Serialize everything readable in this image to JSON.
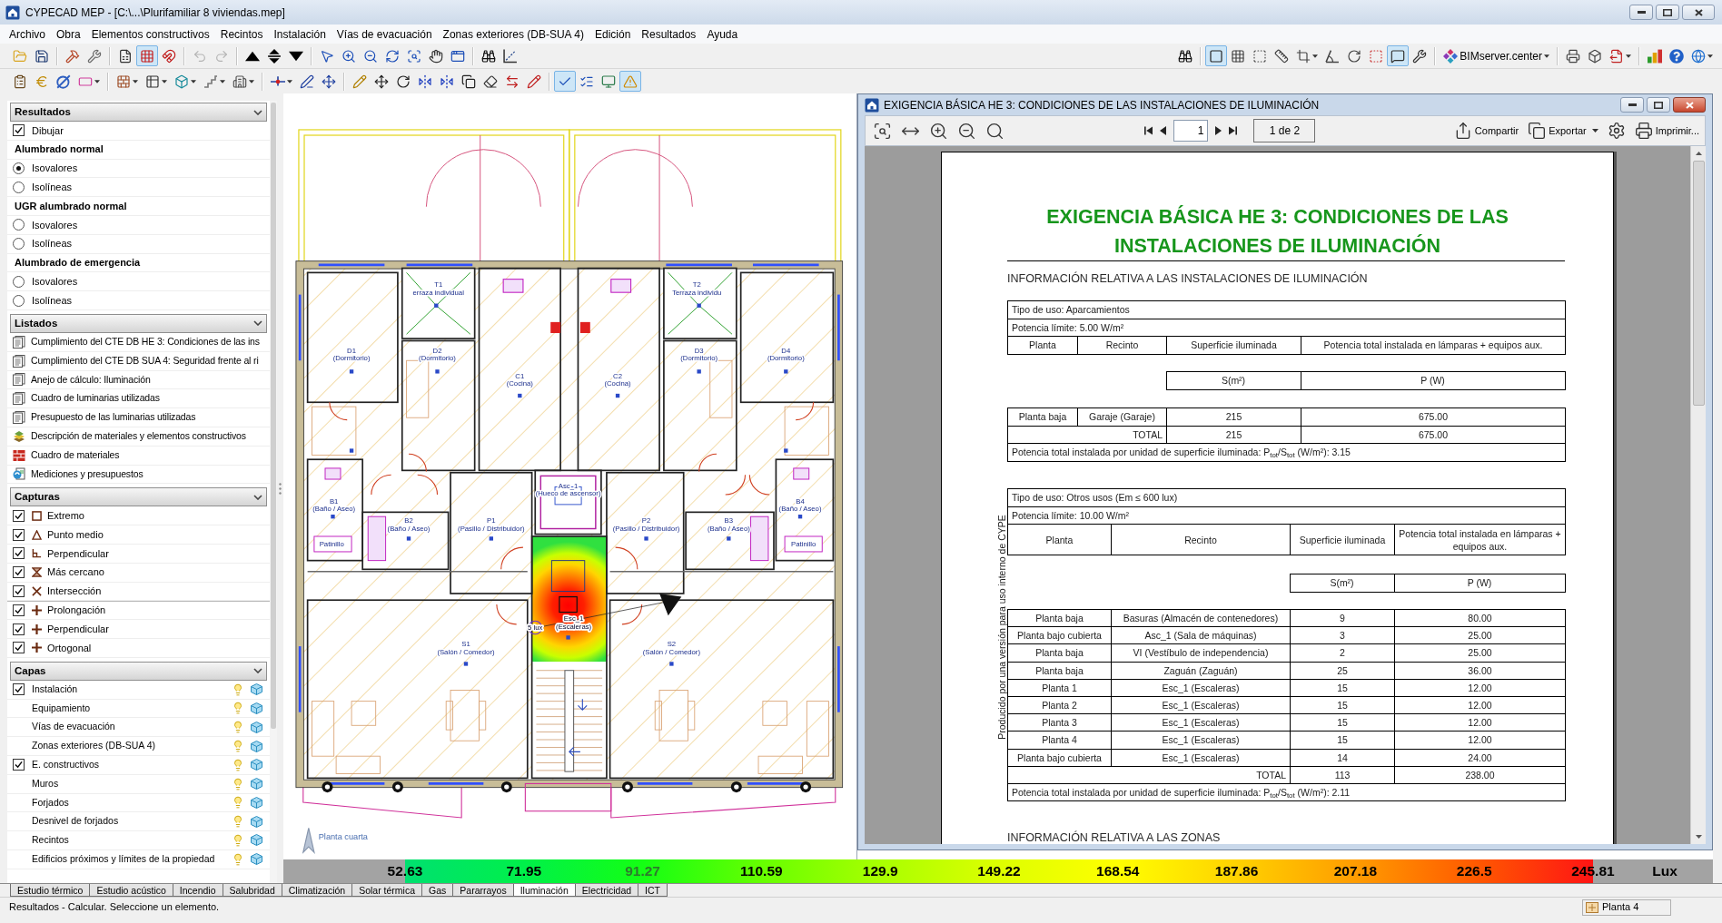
{
  "window": {
    "title": "CYPECAD MEP - [C:\\...\\Plurifamiliar 8 viviendas.mep]"
  },
  "menu": [
    "Archivo",
    "Obra",
    "Elementos constructivos",
    "Recintos",
    "Instalación",
    "Vías de evacuación",
    "Zonas exteriores (DB-SUA 4)",
    "Edición",
    "Resultados",
    "Ayuda"
  ],
  "toolbar_1": {
    "left": [
      [
        {
          "pressed": false,
          "disabled": false
        },
        {
          "pressed": false,
          "disabled": false
        }
      ],
      [
        {
          "pressed": false,
          "disabled": false
        },
        {
          "pressed": false,
          "disabled": false
        }
      ],
      [
        {
          "pressed": false,
          "disabled": false
        },
        {
          "pressed": true,
          "disabled": false
        },
        {
          "pressed": false,
          "disabled": false
        }
      ],
      [
        {
          "pressed": false,
          "disabled": true
        },
        {
          "pressed": false,
          "disabled": true
        }
      ],
      [
        {
          "pressed": false,
          "disabled": false
        },
        {
          "pressed": false,
          "disabled": false
        },
        {
          "pressed": false,
          "disabled": false
        }
      ],
      [
        {
          "pressed": false,
          "disabled": false
        },
        {
          "pressed": false,
          "disabled": false
        },
        {
          "pressed": false,
          "disabled": false
        },
        {
          "pressed": false,
          "disabled": false
        },
        {
          "pressed": false,
          "disabled": false
        },
        {
          "pressed": false,
          "disabled": false
        },
        {
          "pressed": false,
          "disabled": false
        }
      ],
      [
        {
          "pressed": false,
          "disabled": false
        },
        {
          "pressed": false,
          "disabled": false
        }
      ]
    ],
    "right": [
      [
        {
          "pressed": false
        }
      ],
      [
        {
          "pressed": true
        },
        {
          "pressed": false
        },
        {
          "pressed": false
        },
        {
          "pressed": false
        },
        {
          "pressed": false
        },
        {
          "pressed": false
        },
        {
          "pressed": false
        },
        {
          "pressed": false
        },
        {
          "pressed": true
        },
        {
          "pressed": false
        }
      ],
      [
        {
          "label": "BIMserver.center",
          "pressed": false
        }
      ],
      [
        {
          "pressed": false
        },
        {
          "pressed": false
        },
        {
          "pressed": false
        }
      ],
      [
        {
          "pressed": false
        },
        {
          "pressed": false
        },
        {
          "pressed": false
        }
      ]
    ]
  },
  "toolbar_2": {
    "groups": [
      [
        {
          "pressed": false
        },
        {
          "pressed": false
        },
        {
          "pressed": false
        },
        {
          "pressed": false
        }
      ],
      [
        {
          "pressed": false
        },
        {
          "pressed": false
        },
        {
          "pressed": false
        },
        {
          "pressed": false
        },
        {
          "pressed": false
        }
      ],
      [
        {
          "pressed": false
        },
        {
          "pressed": false
        },
        {
          "pressed": false
        }
      ],
      [
        {
          "pressed": false
        },
        {
          "pressed": false
        },
        {
          "pressed": false
        },
        {
          "pressed": false
        },
        {
          "pressed": false
        },
        {
          "pressed": false
        },
        {
          "pressed": false
        },
        {
          "pressed": false
        },
        {
          "pressed": false
        }
      ],
      [
        {
          "pressed": true
        },
        {
          "pressed": false
        },
        {
          "pressed": false
        },
        {
          "pressed": true
        }
      ]
    ]
  },
  "side_panel": {
    "sections": [
      {
        "title": "Resultados",
        "expanded": true,
        "items": [
          {
            "kind": "checkbox",
            "label": "Dibujar",
            "checked": true
          },
          {
            "kind": "heading",
            "label": "Alumbrado normal"
          },
          {
            "kind": "radio",
            "label": "Isovalores",
            "selected": true
          },
          {
            "kind": "radio",
            "label": "Isolíneas",
            "selected": false
          },
          {
            "kind": "heading",
            "label": "UGR alumbrado normal"
          },
          {
            "kind": "radio",
            "label": "Isovalores",
            "selected": false
          },
          {
            "kind": "radio",
            "label": "Isolíneas",
            "selected": false
          },
          {
            "kind": "heading",
            "label": "Alumbrado de emergencia"
          },
          {
            "kind": "radio",
            "label": "Isovalores",
            "selected": false
          },
          {
            "kind": "radio",
            "label": "Isolíneas",
            "selected": false
          }
        ]
      },
      {
        "title": "Listados",
        "expanded": true,
        "items": [
          {
            "kind": "report",
            "label": "Cumplimiento del CTE DB HE 3: Condiciones de las ins"
          },
          {
            "kind": "report",
            "label": "Cumplimiento del CTE DB SUA 4: Seguridad frente al ri"
          },
          {
            "kind": "report",
            "label": "Anejo de cálculo: Iluminación"
          },
          {
            "kind": "report",
            "label": "Cuadro de luminarias utilizadas"
          },
          {
            "kind": "report",
            "label": "Presupuesto de las luminarias utilizadas"
          },
          {
            "kind": "report",
            "label": "Descripción de materiales y elementos constructivos"
          },
          {
            "kind": "report",
            "label": "Cuadro de materiales"
          },
          {
            "kind": "report",
            "label": "Mediciones y presupuestos"
          }
        ]
      },
      {
        "title": "Capturas",
        "expanded": true,
        "items": [
          {
            "kind": "snap",
            "label": "Extremo",
            "checked": true
          },
          {
            "kind": "snap",
            "label": "Punto medio",
            "checked": true
          },
          {
            "kind": "snap",
            "label": "Perpendicular",
            "checked": true
          },
          {
            "kind": "snap",
            "label": "Más cercano",
            "checked": true
          },
          {
            "kind": "snap",
            "label": "Intersección",
            "checked": true
          },
          {
            "kind": "snap",
            "label": "Prolongación",
            "checked": true
          },
          {
            "kind": "snap",
            "label": "Perpendicular",
            "checked": true
          },
          {
            "kind": "snap",
            "label": "Ortogonal",
            "checked": true
          }
        ]
      },
      {
        "title": "Capas",
        "expanded": true,
        "items": [
          {
            "kind": "layer",
            "label": "Instalación",
            "checked": true,
            "children": [
              {
                "label": "Equipamiento"
              },
              {
                "label": "Vías de evacuación"
              },
              {
                "label": "Zonas exteriores (DB-SUA 4)"
              }
            ]
          },
          {
            "kind": "layer",
            "label": "E. constructivos",
            "checked": true,
            "children": [
              {
                "label": "Muros"
              },
              {
                "label": "Forjados"
              },
              {
                "label": "Desnivel de forjados"
              },
              {
                "label": "Recintos"
              },
              {
                "label": "Edificios próximos y límites de la propiedad"
              }
            ]
          }
        ]
      }
    ]
  },
  "drawing": {
    "labels": [
      {
        "lines": [
          "T1",
          "erraza individual"
        ]
      },
      {
        "lines": [
          "T2",
          "Terraza individu"
        ]
      },
      {
        "lines": [
          "D1",
          "(Dormitorio)"
        ]
      },
      {
        "lines": [
          "D2",
          "(Dormitorio)"
        ]
      },
      {
        "lines": [
          "C1",
          "(Cocina)"
        ]
      },
      {
        "lines": [
          "C2",
          "(Cocina)"
        ]
      },
      {
        "lines": [
          "D3",
          "(Dormitorio)"
        ]
      },
      {
        "lines": [
          "D4",
          "(Dormitorio)"
        ]
      },
      {
        "lines": [
          "Asc_1",
          "(Hueco de ascensor)"
        ]
      },
      {
        "lines": [
          "B1",
          "(Baño / Aseo)"
        ]
      },
      {
        "lines": [
          "B2",
          "(Baño / Aseo)"
        ]
      },
      {
        "lines": [
          "P1",
          "(Pasillo / Distribuidor)"
        ]
      },
      {
        "lines": [
          "P2",
          "(Pasillo / Distribuidor)"
        ]
      },
      {
        "lines": [
          "B3",
          "(Baño / Aseo)"
        ]
      },
      {
        "lines": [
          "B4",
          "(Baño / Aseo)"
        ]
      },
      {
        "lines": [
          "Patinillo"
        ]
      },
      {
        "lines": [
          "Patinillo"
        ]
      },
      {
        "lines": [
          "S1",
          "(Salón / Comedor)"
        ]
      },
      {
        "lines": [
          "Esc_1",
          "(Escaleras)"
        ]
      },
      {
        "lines": [
          "S2",
          "(Salón / Comedor)"
        ]
      },
      {
        "lines": [
          "5 lux"
        ]
      }
    ],
    "floor_name": "Planta cuarta"
  },
  "document_window": {
    "title": "EXIGENCIA BÁSICA HE 3: CONDICIONES DE LAS INSTALACIONES DE ILUMINACIÓN",
    "page": "1",
    "page_count": "1 de 2",
    "actions": [
      {
        "kind": "button",
        "label": "Compartir"
      },
      {
        "kind": "dropdown",
        "label": "Exportar"
      },
      {
        "kind": "icon"
      },
      {
        "kind": "button",
        "label": "Imprimir..."
      }
    ]
  },
  "document": {
    "title": "EXIGENCIA BÁSICA HE 3: CONDICIONES DE LAS INSTALACIONES DE ILUMINACIÓN",
    "section": "INFORMACIÓN RELATIVA A LAS INSTALACIONES DE ILUMINACIÓN",
    "watermark": "Producido por una versión para uso interno de CYPE",
    "tables": [
      {
        "use": "Tipo de uso: Aparcamientos",
        "limit": "Potencia límite: 5.00 W/m²",
        "columns": [
          "Planta",
          "Recinto",
          "Superficie iluminada",
          "Potencia total instalada en lámparas + equipos aux."
        ],
        "units": [
          "S(m²)",
          "P (W)"
        ],
        "rows": [
          [
            "Planta baja",
            "Garaje (Garaje)",
            "215",
            "675.00"
          ]
        ],
        "total": [
          "TOTAL",
          "215",
          "675.00"
        ],
        "ratio": "Potencia total instalada por unidad de superficie iluminada: P$_{tot}$/S$_{tot}$ (W/m²): 3.15"
      },
      {
        "use": "Tipo de uso: Otros usos (Em ≤ 600 lux)",
        "limit": "Potencia límite: 10.00 W/m²",
        "columns": [
          "Planta",
          "Recinto",
          "Superficie iluminada",
          "Potencia total instalada en lámparas + equipos aux."
        ],
        "units": [
          "S(m²)",
          "P (W)"
        ],
        "rows": [
          [
            "Planta baja",
            "Basuras (Almacén de contenedores)",
            "9",
            "80.00"
          ],
          [
            "Planta bajo cubierta",
            "Asc_1 (Sala de máquinas)",
            "3",
            "25.00"
          ],
          [
            "Planta baja",
            "VI (Vestíbulo de independencia)",
            "2",
            "25.00"
          ],
          [
            "Planta baja",
            "Zaguán (Zaguán)",
            "25",
            "36.00"
          ],
          [
            "Planta 1",
            "Esc_1 (Escaleras)",
            "15",
            "12.00"
          ],
          [
            "Planta 2",
            "Esc_1 (Escaleras)",
            "15",
            "12.00"
          ],
          [
            "Planta 3",
            "Esc_1 (Escaleras)",
            "15",
            "12.00"
          ],
          [
            "Planta 4",
            "Esc_1 (Escaleras)",
            "15",
            "12.00"
          ],
          [
            "Planta bajo cubierta",
            "Esc_1 (Escaleras)",
            "14",
            "24.00"
          ]
        ],
        "total": [
          "TOTAL",
          "113",
          "238.00"
        ],
        "ratio": "Potencia total instalada por unidad de superficie iluminada: P$_{tot}$/S$_{tot}$ (W/m²): 2.11"
      }
    ],
    "next_section": "INFORMACIÓN RELATIVA A LAS ZONAS"
  },
  "legend": {
    "values": [
      {
        "text": "52.63",
        "muted": false
      },
      {
        "text": "71.95",
        "muted": false
      },
      {
        "text": "91.27",
        "muted": true
      },
      {
        "text": "110.59",
        "muted": false
      },
      {
        "text": "129.9",
        "muted": false
      },
      {
        "text": "149.22",
        "muted": false
      },
      {
        "text": "168.54",
        "muted": false
      },
      {
        "text": "187.86",
        "muted": false
      },
      {
        "text": "207.18",
        "muted": false
      },
      {
        "text": "226.5",
        "muted": false
      },
      {
        "text": "245.81",
        "muted": false
      }
    ],
    "unit": "Lux"
  },
  "bottom_tabs": [
    {
      "label": "Estudio térmico",
      "selected": false
    },
    {
      "label": "Estudio acústico",
      "selected": false
    },
    {
      "label": "Incendio",
      "selected": false
    },
    {
      "label": "Salubridad",
      "selected": false
    },
    {
      "label": "Climatización",
      "selected": false
    },
    {
      "label": "Solar térmica",
      "selected": false
    },
    {
      "label": "Gas",
      "selected": false
    },
    {
      "label": "Pararrayos",
      "selected": false
    },
    {
      "label": "Iluminación",
      "selected": true
    },
    {
      "label": "Electricidad",
      "selected": false
    },
    {
      "label": "ICT",
      "selected": false
    }
  ],
  "status_bar": {
    "message": "Resultados - Calcular. Seleccione un elemento.",
    "floor": "Planta 4"
  }
}
